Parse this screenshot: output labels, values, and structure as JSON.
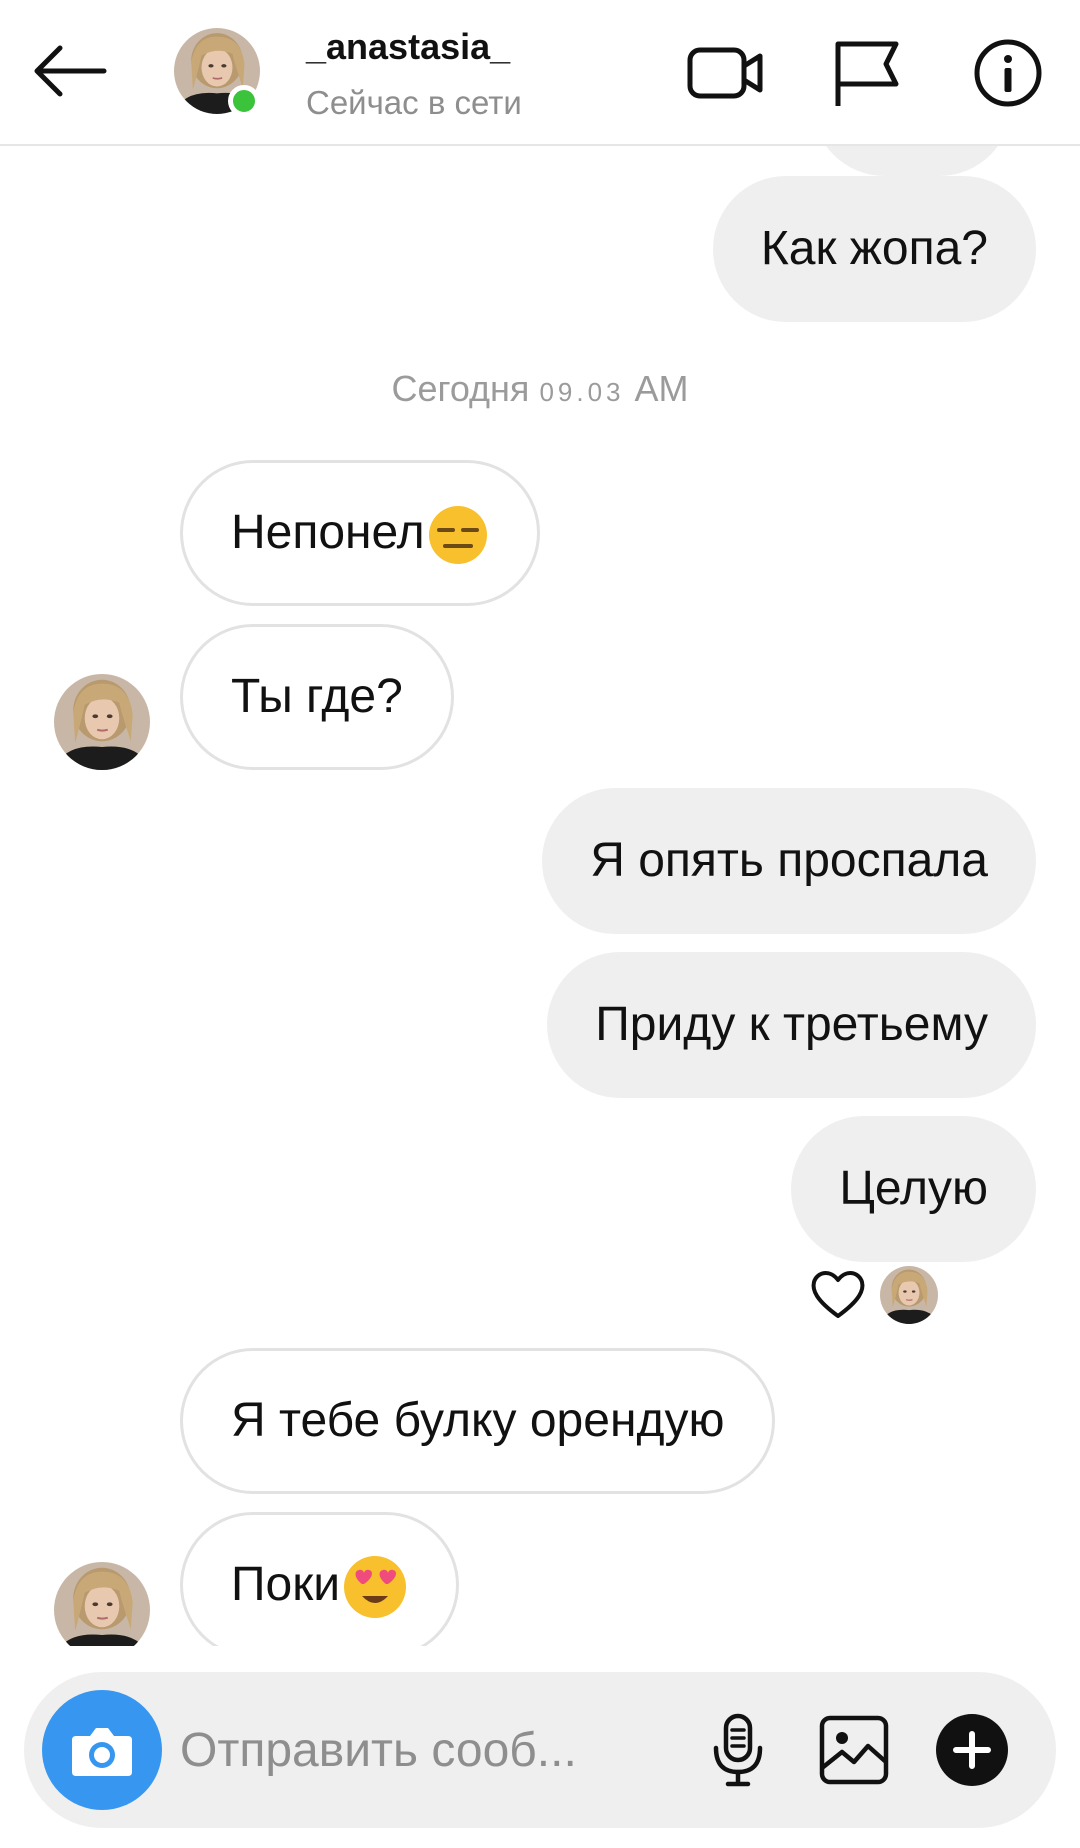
{
  "header": {
    "username": "_anastasia_",
    "status": "Сейчас в сети"
  },
  "timestamp": {
    "day": "Сегодня",
    "time": "09.03",
    "ampm": "AM"
  },
  "messages": [
    {
      "id": "m1",
      "direction": "out",
      "text": "Как жопа?"
    },
    {
      "id": "m2",
      "direction": "in",
      "text": "Непонел",
      "emoji": "expressionless-face"
    },
    {
      "id": "m3",
      "direction": "in",
      "text": "Ты где?"
    },
    {
      "id": "m4",
      "direction": "out",
      "text": "Я опять проспала"
    },
    {
      "id": "m5",
      "direction": "out",
      "text": "Приду к третьему"
    },
    {
      "id": "m6",
      "direction": "out",
      "text": "Целую",
      "reaction": "heart-icon"
    },
    {
      "id": "m7",
      "direction": "in",
      "text": "Я тебе булку орендую"
    },
    {
      "id": "m8",
      "direction": "in",
      "text": "Поки",
      "emoji": "heart-eyes-face"
    }
  ],
  "composer": {
    "placeholder": "Отправить сооб..."
  },
  "colors": {
    "accent": "#3797f0",
    "online": "#3cc33c",
    "outgoing_bubble": "#efefef",
    "incoming_border": "#e2e2e2"
  }
}
